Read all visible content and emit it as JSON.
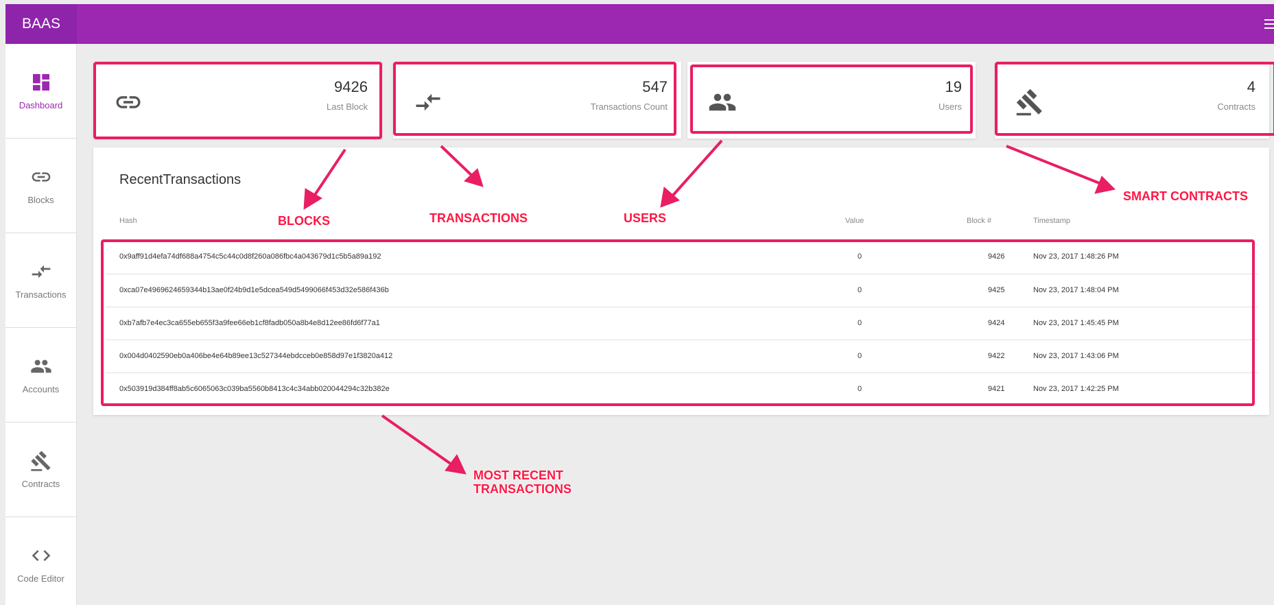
{
  "header": {
    "brand": "BAAS",
    "menu_icon": "menu-icon"
  },
  "sidebar": {
    "items": [
      {
        "label": "Dashboard",
        "icon": "dashboard-icon",
        "active": true
      },
      {
        "label": "Blocks",
        "icon": "link-icon",
        "active": false
      },
      {
        "label": "Transactions",
        "icon": "compare-arrows-icon",
        "active": false
      },
      {
        "label": "Accounts",
        "icon": "people-icon",
        "active": false
      },
      {
        "label": "Contracts",
        "icon": "gavel-icon",
        "active": false
      },
      {
        "label": "Code Editor",
        "icon": "code-icon",
        "active": false
      }
    ]
  },
  "stats": {
    "blocks": {
      "value": "9426",
      "label": "Last Block",
      "icon": "link-icon"
    },
    "transactions": {
      "value": "547",
      "label": "Transactions Count",
      "icon": "compare-arrows-icon"
    },
    "users": {
      "value": "19",
      "label": "Users",
      "icon": "people-icon"
    },
    "contracts": {
      "value": "4",
      "label": "Contracts",
      "icon": "gavel-icon"
    }
  },
  "recent": {
    "title": "RecentTransactions",
    "columns": {
      "hash": "Hash",
      "value": "Value",
      "block": "Block #",
      "timestamp": "Timestamp"
    },
    "rows": [
      {
        "hash": "0x9aff91d4efa74df688a4754c5c44c0d8f260a086fbc4a043679d1c5b5a89a192",
        "value": "0",
        "block": "9426",
        "timestamp": "Nov 23, 2017 1:48:26 PM"
      },
      {
        "hash": "0xca07e4969624659344b13ae0f24b9d1e5dcea549d5499066f453d32e586f436b",
        "value": "0",
        "block": "9425",
        "timestamp": "Nov 23, 2017 1:48:04 PM"
      },
      {
        "hash": "0xb7afb7e4ec3ca655eb655f3a9fee66eb1cf8fadb050a8b4e8d12ee86fd6f77a1",
        "value": "0",
        "block": "9424",
        "timestamp": "Nov 23, 2017 1:45:45 PM"
      },
      {
        "hash": "0x004d0402590eb0a406be4e64b89ee13c527344ebdcceb0e858d97e1f3820a412",
        "value": "0",
        "block": "9422",
        "timestamp": "Nov 23, 2017 1:43:06 PM"
      },
      {
        "hash": "0x503919d384ff8ab5c6065063c039ba5560b8413c4c34abb020044294c32b382e",
        "value": "0",
        "block": "9421",
        "timestamp": "Nov 23, 2017 1:42:25 PM"
      }
    ]
  },
  "annotations": {
    "blocks": "BLOCKS",
    "transactions": "TRANSACTIONS",
    "users": "USERS",
    "smart_contracts": "SMART CONTRACTS",
    "most_recent_1": "MOST RECENT",
    "most_recent_2": "TRANSACTIONS"
  },
  "colors": {
    "primary": "#9c27b0",
    "annotation": "#e91e63",
    "annotation_text": "#ff1744"
  }
}
